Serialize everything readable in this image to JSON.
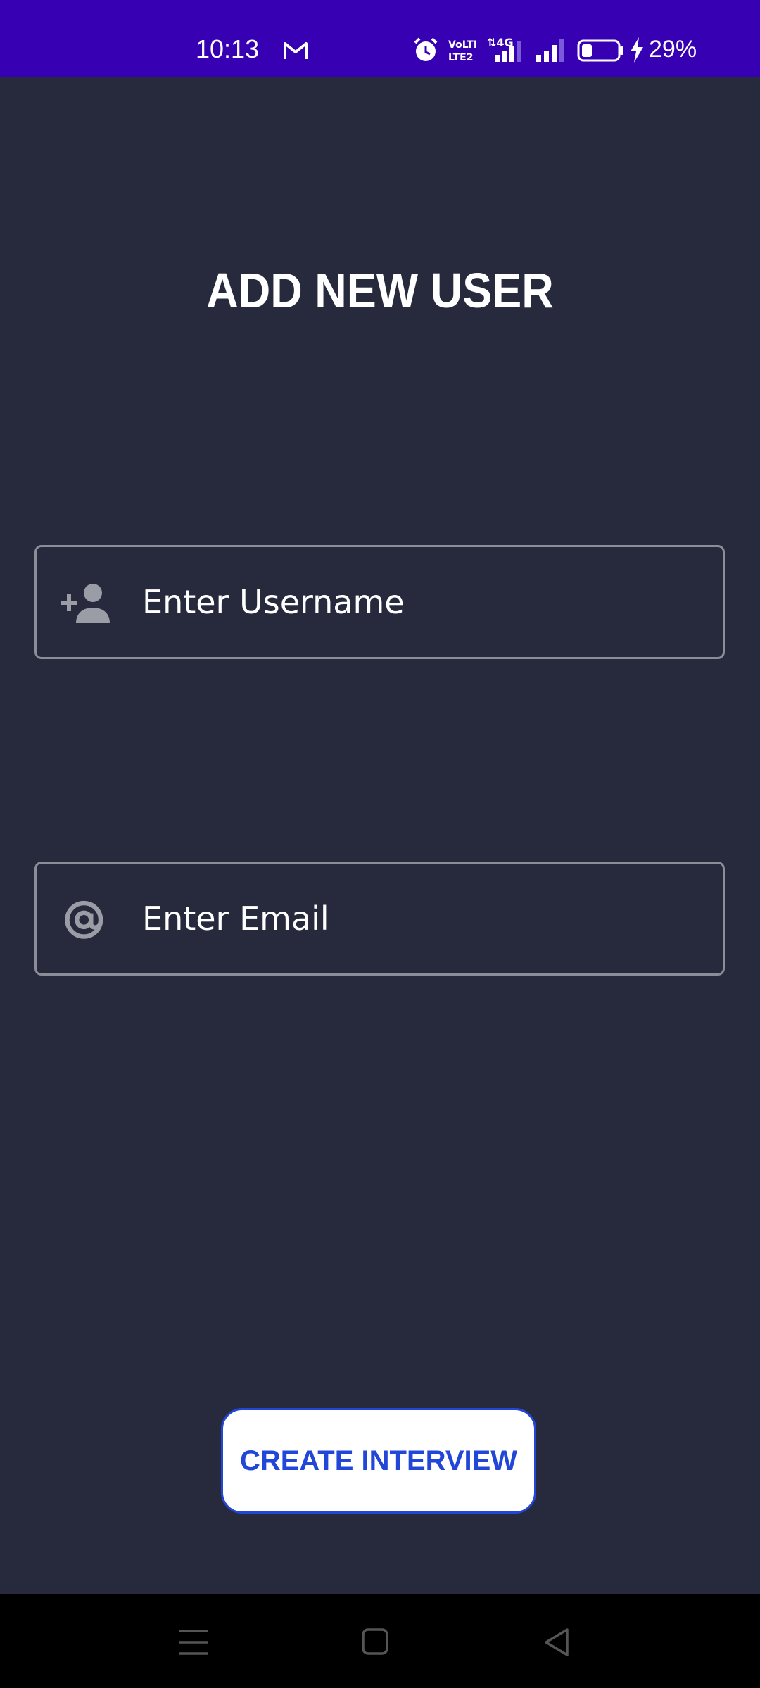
{
  "status_bar": {
    "time": "10:13",
    "battery_text": "29%",
    "icons": [
      "gmail-icon",
      "alarm-icon",
      "volte-icon",
      "signal-4g-icon",
      "signal-icon",
      "battery-icon",
      "charging-icon"
    ],
    "background": "#3700b3"
  },
  "page": {
    "title": "ADD NEW USER",
    "background": "#262a3c"
  },
  "username_field": {
    "placeholder": "Enter Username",
    "value": "",
    "icon": "add-person-icon"
  },
  "email_field": {
    "placeholder": "Enter Email",
    "value": "",
    "icon": "at-sign-icon"
  },
  "create_button": {
    "label": "CREATE INTERVIEW",
    "accent": "#2246d8"
  },
  "nav_bar": {
    "buttons": [
      "menu-icon",
      "home-icon",
      "back-icon"
    ]
  }
}
